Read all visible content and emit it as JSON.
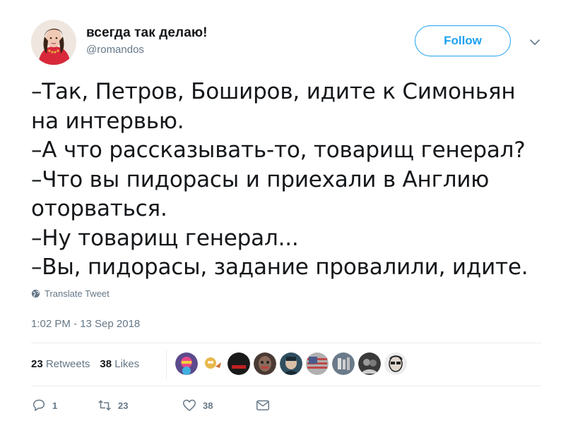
{
  "user": {
    "display_name": "всегда так делаю!",
    "handle": "@romandos"
  },
  "follow_label": "Follow",
  "tweet": {
    "lines": [
      "–Так, Петров, Боширов, идите к Симоньян",
      "на интервью.",
      "–А что рассказывать-то, товарищ генерал?",
      "–Что вы пидорасы и приехали в Англию",
      "оторваться.",
      "–Ну товарищ генерал...",
      "–Вы, пидорасы, задание провалили, идите."
    ]
  },
  "translate_label": "Translate Tweet",
  "timestamp": "1:02 PM - 13 Sep 2018",
  "stats": {
    "retweets_count": "23",
    "retweets_label": "Retweets",
    "likes_count": "38",
    "likes_label": "Likes"
  },
  "likers": [
    {
      "name": "liker-1",
      "color": "#5b4a8c"
    },
    {
      "name": "liker-2",
      "color": "#e8b84a"
    },
    {
      "name": "liker-3",
      "color": "#1a1a1a"
    },
    {
      "name": "liker-4",
      "color": "#8a6a5a"
    },
    {
      "name": "liker-5",
      "color": "#2f4f5f"
    },
    {
      "name": "liker-6",
      "color": "#b0b0b0"
    },
    {
      "name": "liker-7",
      "color": "#6a7a8a"
    },
    {
      "name": "liker-8",
      "color": "#3a3a3a"
    },
    {
      "name": "liker-9",
      "color": "#d8d8d8"
    }
  ],
  "actions": {
    "reply_count": "1",
    "retweet_count": "23",
    "like_count": "38"
  },
  "colors": {
    "accent": "#1da1f2",
    "muted": "#657786",
    "text": "#14171a",
    "separator": "#e6ecf0"
  }
}
